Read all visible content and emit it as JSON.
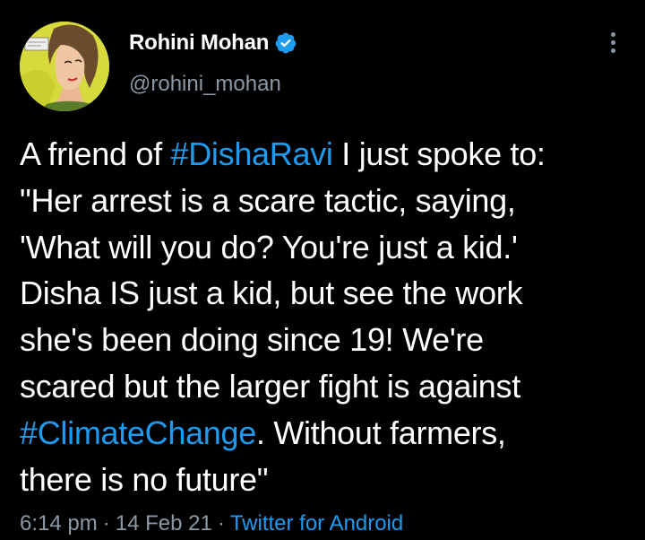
{
  "author": {
    "display_name": "Rohini Mohan",
    "handle": "@rohini_mohan",
    "verified": true
  },
  "tweet": {
    "lines": [
      {
        "pre": "A friend of ",
        "tag": "#DishaRavi",
        "post": " I just spoke to:"
      },
      {
        "pre": "\"Her arrest is a scare tactic, saying,",
        "tag": "",
        "post": ""
      },
      {
        "pre": "'What will you do? You're just a kid.'",
        "tag": "",
        "post": ""
      },
      {
        "pre": "Disha IS just a kid, but see the work",
        "tag": "",
        "post": ""
      },
      {
        "pre": "she's been doing since 19! We're",
        "tag": "",
        "post": ""
      },
      {
        "pre": "scared but the larger fight is against",
        "tag": "",
        "post": ""
      },
      {
        "pre": "",
        "tag": "#ClimateChange",
        "post": ". Without farmers,"
      },
      {
        "pre": "there is no future\"",
        "tag": "",
        "post": ""
      }
    ]
  },
  "meta": {
    "time": "6:14 pm",
    "separator": "·",
    "date": "14 Feb 21",
    "source": "Twitter for Android"
  },
  "icons": {
    "verified": "verified-badge-icon",
    "more": "more-options-icon"
  },
  "colors": {
    "background": "#000000",
    "link": "#1d9bf0",
    "secondary": "#8b98a5",
    "avatar_bg": "#d9dd3a"
  }
}
